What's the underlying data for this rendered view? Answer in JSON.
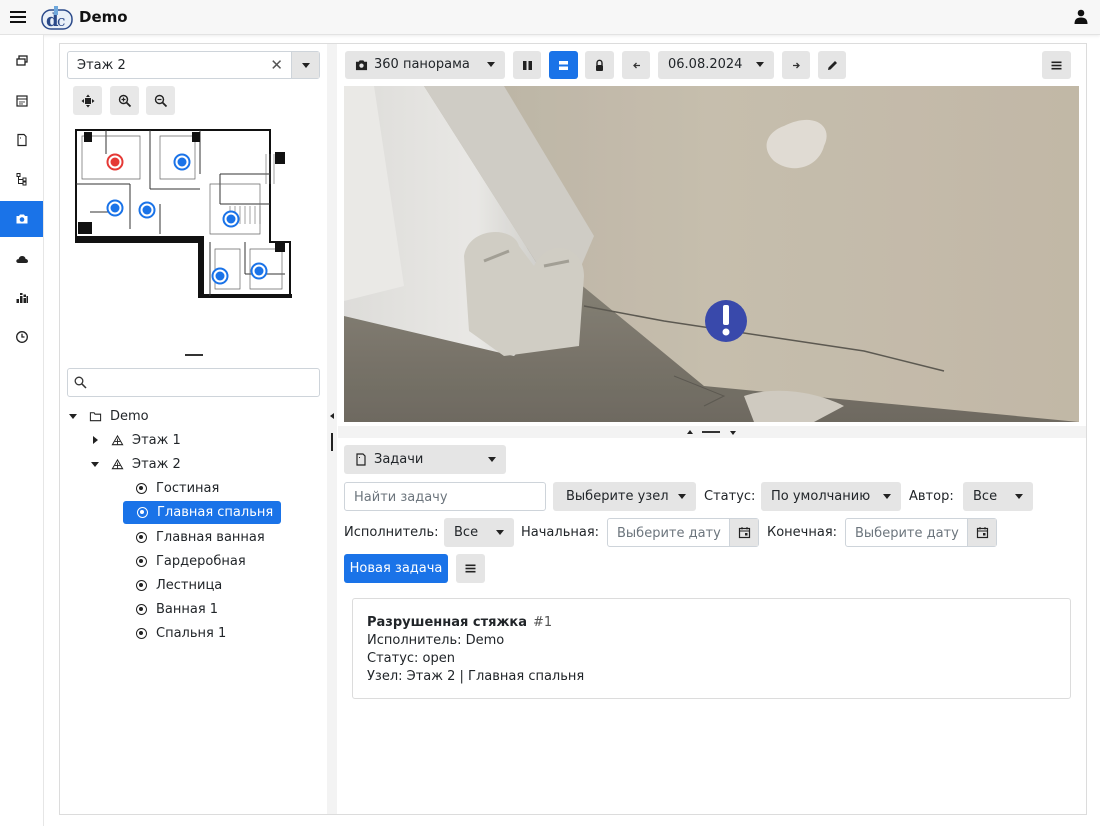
{
  "app": {
    "title": "Demo"
  },
  "sidebar_icons": [
    "layers-icon",
    "calendar-grid-icon",
    "document-icon",
    "hierarchy-icon",
    "camera-icon",
    "cloud-icon",
    "dashboard-icon",
    "clock-icon"
  ],
  "floor_select": {
    "value": "Этаж 2",
    "clear": "✕"
  },
  "tree": {
    "search_placeholder": "",
    "root": "Demo",
    "floors": [
      {
        "label": "Этаж 1",
        "expanded": false
      },
      {
        "label": "Этаж 2",
        "expanded": true
      }
    ],
    "rooms": [
      "Гостиная",
      "Главная спальня",
      "Главная ванная",
      "Гардеробная",
      "Лестница",
      "Ванная 1",
      "Спальня 1"
    ],
    "selected_room": "Главная спальня"
  },
  "toolbar": {
    "view_mode": "360 панорама",
    "date": "06.08.2024"
  },
  "tasks": {
    "panel_select": "Задачи",
    "search_placeholder": "Найти задачу",
    "node_select": "Выберите узел",
    "status_label": "Статус:",
    "status_value": "По умолчанию",
    "author_label": "Автор:",
    "author_value": "Все",
    "assignee_label": "Исполнитель:",
    "assignee_value": "Все",
    "start_label": "Начальная:",
    "start_placeholder": "Выберите дату",
    "end_label": "Конечная:",
    "end_placeholder": "Выберите дату",
    "new_task": "Новая задача",
    "items": [
      {
        "title": "Разрушенная стяжка",
        "number": "#1",
        "assignee": "Исполнитель: Demo",
        "status": "Статус: open",
        "node": "Узел: Этаж 2 | Главная спальня"
      }
    ]
  },
  "colors": {
    "accent": "#1a73e8",
    "marker_red": "#e53935",
    "marker_blue": "#1a73e8",
    "issue_marker": "#3949ab"
  }
}
